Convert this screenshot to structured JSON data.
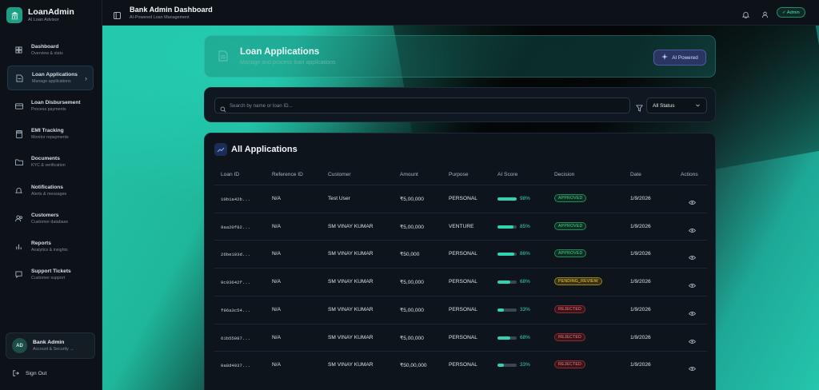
{
  "sidebar": {
    "brand_title": "LoanAdmin",
    "brand_sub": "AI Loan Advisor",
    "items": [
      {
        "label": "Dashboard",
        "sub": "Overview & stats",
        "icon": "dashboard-icon"
      },
      {
        "label": "Loan Applications",
        "sub": "Manage applications",
        "icon": "document-icon",
        "active": true
      },
      {
        "label": "Loan Disbursement",
        "sub": "Process payments",
        "icon": "credit-card-icon"
      },
      {
        "label": "EMI Tracking",
        "sub": "Monitor repayments",
        "icon": "calculator-icon"
      },
      {
        "label": "Documents",
        "sub": "KYC & verification",
        "icon": "folder-icon"
      },
      {
        "label": "Notifications",
        "sub": "Alerts & messages",
        "icon": "bell-icon"
      },
      {
        "label": "Customers",
        "sub": "Customer database",
        "icon": "users-icon"
      },
      {
        "label": "Reports",
        "sub": "Analytics & insights",
        "icon": "bar-chart-icon"
      },
      {
        "label": "Support Tickets",
        "sub": "Customer support",
        "icon": "message-icon"
      }
    ],
    "profile": {
      "initials": "AD",
      "name": "Bank Admin",
      "sub": "Account & Security →"
    },
    "signout": "Sign Out"
  },
  "header": {
    "title": "Bank Admin Dashboard",
    "subtitle": "AI-Powered Loan Management",
    "admin_badge": "✓ Admin"
  },
  "hero": {
    "title": "Loan Applications",
    "subtitle": "Manage and process loan applications",
    "ai_button": "AI Powered"
  },
  "search": {
    "placeholder": "Search by name or loan ID...",
    "status_selected": "All Status"
  },
  "table": {
    "title": "All Applications",
    "headers": [
      "Loan ID",
      "Reference ID",
      "Customer",
      "Amount",
      "Purpose",
      "AI Score",
      "Decision",
      "Date",
      "Actions"
    ],
    "rows": [
      {
        "loan_id": "10b1a42b...",
        "ref": "N/A",
        "customer": "Test User",
        "amount": "₹5,00,000",
        "purpose": "PERSONAL",
        "score": 98,
        "score_label": "98%",
        "decision": "APPROVED",
        "status": "approved",
        "date": "1/9/2026"
      },
      {
        "loan_id": "9aa20f82...",
        "ref": "N/A",
        "customer": "SM VINAY KUMAR",
        "amount": "₹5,00,000",
        "purpose": "VENTURE",
        "score": 85,
        "score_label": "85%",
        "decision": "APPROVED",
        "status": "approved",
        "date": "1/9/2026"
      },
      {
        "loan_id": "26be103d...",
        "ref": "N/A",
        "customer": "SM VINAY KUMAR",
        "amount": "₹50,000",
        "purpose": "PERSONAL",
        "score": 86,
        "score_label": "86%",
        "decision": "APPROVED",
        "status": "approved",
        "date": "1/9/2026"
      },
      {
        "loan_id": "9c93642f...",
        "ref": "N/A",
        "customer": "SM VINAY KUMAR",
        "amount": "₹5,00,000",
        "purpose": "PERSONAL",
        "score": 68,
        "score_label": "68%",
        "decision": "PENDING_REVIEW",
        "status": "pending",
        "date": "1/9/2026"
      },
      {
        "loan_id": "f96a3c54...",
        "ref": "N/A",
        "customer": "SM VINAY KUMAR",
        "amount": "₹5,00,000",
        "purpose": "PERSONAL",
        "score": 33,
        "score_label": "33%",
        "decision": "REJECTED",
        "status": "rejected",
        "date": "1/9/2026"
      },
      {
        "loan_id": "61b55087...",
        "ref": "N/A",
        "customer": "SM VINAY KUMAR",
        "amount": "₹5,00,000",
        "purpose": "PERSONAL",
        "score": 68,
        "score_label": "68%",
        "decision": "REJECTED",
        "status": "rejected",
        "date": "1/9/2026"
      },
      {
        "loan_id": "0a8d4037...",
        "ref": "N/A",
        "customer": "SM VINAY KUMAR",
        "amount": "₹50,00,000",
        "purpose": "PERSONAL",
        "score": 33,
        "score_label": "33%",
        "decision": "REJECTED",
        "status": "rejected",
        "date": "1/9/2026"
      }
    ]
  },
  "colors": {
    "accent": "#2fd4b0",
    "approved": "#45d68e",
    "pending": "#f1cf4a",
    "rejected": "#f07b86"
  }
}
